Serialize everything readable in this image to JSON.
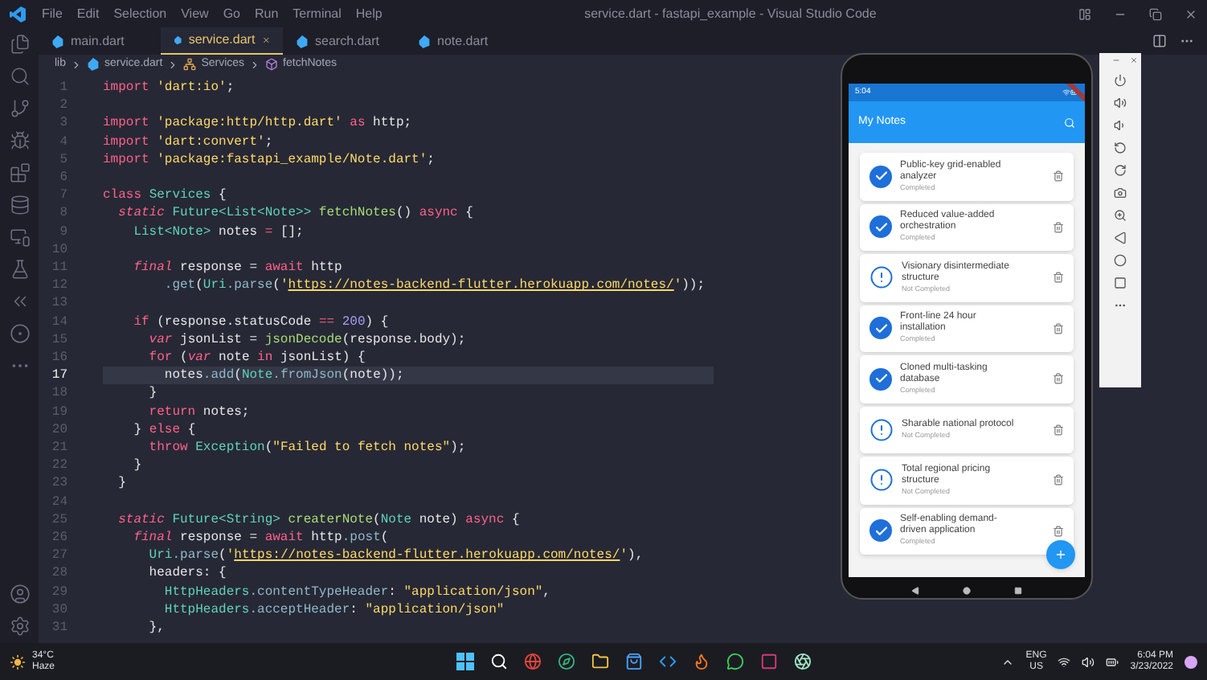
{
  "window": {
    "title": "service.dart - fastapi_example - Visual Studio Code",
    "menu": [
      "File",
      "Edit",
      "Selection",
      "View",
      "Go",
      "Run",
      "Terminal",
      "Help"
    ]
  },
  "tabs": [
    {
      "label": "main.dart",
      "selected": false
    },
    {
      "label": "service.dart",
      "selected": true
    },
    {
      "label": "search.dart",
      "selected": false
    },
    {
      "label": "note.dart",
      "selected": false
    }
  ],
  "breadcrumb": [
    {
      "kind": "folder",
      "label": "lib"
    },
    {
      "kind": "file",
      "label": "service.dart"
    },
    {
      "kind": "class",
      "label": "Services"
    },
    {
      "kind": "method",
      "label": "fetchNotes"
    }
  ],
  "editor": {
    "lines": [
      {
        "n": "1",
        "current": false,
        "tokens": [
          {
            "kind": "kw",
            "text": "import"
          },
          {
            "kind": "str",
            "text": " 'dart:io'"
          },
          {
            "kind": "txt",
            "text": ";"
          }
        ]
      },
      {
        "n": "2",
        "current": false
      },
      {
        "n": "3",
        "current": false,
        "tokens": [
          {
            "kind": "kw",
            "text": "import"
          },
          {
            "kind": "str",
            "text": " 'package:http/http.dart'"
          },
          {
            "kind": "kw",
            "text": " as"
          },
          {
            "kind": "txt",
            "text": " http;"
          }
        ]
      },
      {
        "n": "4",
        "current": false,
        "tokens": [
          {
            "kind": "kw",
            "text": "import"
          },
          {
            "kind": "str",
            "text": " 'dart:convert'"
          },
          {
            "kind": "txt",
            "text": ";"
          }
        ]
      },
      {
        "n": "5",
        "current": false,
        "tokens": [
          {
            "kind": "kw",
            "text": "import"
          },
          {
            "kind": "str",
            "text": " 'package:fastapi_example/Note.dart'"
          },
          {
            "kind": "txt",
            "text": ";"
          }
        ]
      },
      {
        "n": "6",
        "current": false
      },
      {
        "n": "7",
        "current": false,
        "tokens": [
          {
            "kind": "kw",
            "text": "class"
          },
          {
            "kind": "type",
            "text": " Services"
          },
          {
            "kind": "txt",
            "text": " {"
          }
        ]
      },
      {
        "n": "8",
        "current": false,
        "tokens": [
          {
            "kind": "ikw",
            "text": "  static"
          },
          {
            "kind": "type",
            "text": " Future<List<Note>>"
          },
          {
            "kind": "fn",
            "text": " fetchNotes"
          },
          {
            "kind": "txt",
            "text": "() "
          },
          {
            "kind": "kw",
            "text": "async"
          },
          {
            "kind": "txt",
            "text": " {"
          }
        ]
      },
      {
        "n": "9",
        "current": false,
        "tokens": [
          {
            "kind": "type",
            "text": "    List<Note>"
          },
          {
            "kind": "txt",
            "text": " notes "
          },
          {
            "kind": "kw",
            "text": "="
          },
          {
            "kind": "txt",
            "text": " [];"
          }
        ]
      },
      {
        "n": "10",
        "current": false
      },
      {
        "n": "11",
        "current": false,
        "tokens": [
          {
            "kind": "ikw",
            "text": "    final"
          },
          {
            "kind": "txt",
            "text": " response = "
          },
          {
            "kind": "kw",
            "text": "await"
          },
          {
            "kind": "txt",
            "text": " http"
          }
        ]
      },
      {
        "n": "12",
        "current": false,
        "tokens": [
          {
            "kind": "prop",
            "text": "        .get"
          },
          {
            "kind": "txt",
            "text": "("
          },
          {
            "kind": "type",
            "text": "Uri"
          },
          {
            "kind": "prop",
            "text": ".parse"
          },
          {
            "kind": "txt",
            "text": "("
          },
          {
            "kind": "str",
            "text": "'"
          },
          {
            "kind": "url",
            "text": "https://notes-backend-flutter.herokuapp.com/notes/"
          },
          {
            "kind": "str",
            "text": "'"
          },
          {
            "kind": "txt",
            "text": "));"
          }
        ]
      },
      {
        "n": "13",
        "current": false
      },
      {
        "n": "14",
        "current": false,
        "tokens": [
          {
            "kind": "kw",
            "text": "    if"
          },
          {
            "kind": "txt",
            "text": " (response.statusCode "
          },
          {
            "kind": "kw",
            "text": "=="
          },
          {
            "kind": "num",
            "text": " 200"
          },
          {
            "kind": "txt",
            "text": ") {"
          }
        ]
      },
      {
        "n": "15",
        "current": false,
        "tokens": [
          {
            "kind": "ikw",
            "text": "      var"
          },
          {
            "kind": "txt",
            "text": " jsonList = "
          },
          {
            "kind": "fn",
            "text": "jsonDecode"
          },
          {
            "kind": "txt",
            "text": "(response.body);"
          }
        ]
      },
      {
        "n": "16",
        "current": false,
        "tokens": [
          {
            "kind": "kw",
            "text": "      for"
          },
          {
            "kind": "txt",
            "text": " ("
          },
          {
            "kind": "ikw",
            "text": "var"
          },
          {
            "kind": "txt",
            "text": " note "
          },
          {
            "kind": "kw",
            "text": "in"
          },
          {
            "kind": "txt",
            "text": " jsonList) {"
          }
        ]
      },
      {
        "n": "17",
        "current": true,
        "tokens": [
          {
            "kind": "txt",
            "text": "        notes"
          },
          {
            "kind": "prop",
            "text": ".add"
          },
          {
            "kind": "txt",
            "text": "("
          },
          {
            "kind": "type",
            "text": "Note"
          },
          {
            "kind": "prop",
            "text": ".fromJson"
          },
          {
            "kind": "txt",
            "text": "(note));"
          }
        ]
      },
      {
        "n": "18",
        "current": false,
        "tokens": [
          {
            "kind": "txt",
            "text": "      }"
          }
        ]
      },
      {
        "n": "19",
        "current": false,
        "tokens": [
          {
            "kind": "kw",
            "text": "      return"
          },
          {
            "kind": "txt",
            "text": " notes;"
          }
        ]
      },
      {
        "n": "20",
        "current": false,
        "tokens": [
          {
            "kind": "txt",
            "text": "    } "
          },
          {
            "kind": "kw",
            "text": "else"
          },
          {
            "kind": "txt",
            "text": " {"
          }
        ]
      },
      {
        "n": "21",
        "current": false,
        "tokens": [
          {
            "kind": "kw",
            "text": "      throw"
          },
          {
            "kind": "type",
            "text": " Exception"
          },
          {
            "kind": "txt",
            "text": "("
          },
          {
            "kind": "str",
            "text": "\"Failed to fetch notes\""
          },
          {
            "kind": "txt",
            "text": ");"
          }
        ]
      },
      {
        "n": "22",
        "current": false,
        "tokens": [
          {
            "kind": "txt",
            "text": "    }"
          }
        ]
      },
      {
        "n": "23",
        "current": false,
        "tokens": [
          {
            "kind": "txt",
            "text": "  }"
          }
        ]
      },
      {
        "n": "24",
        "current": false
      },
      {
        "n": "25",
        "current": false,
        "tokens": [
          {
            "kind": "ikw",
            "text": "  static"
          },
          {
            "kind": "type",
            "text": " Future<String>"
          },
          {
            "kind": "fn",
            "text": " createrNote"
          },
          {
            "kind": "txt",
            "text": "("
          },
          {
            "kind": "type",
            "text": "Note"
          },
          {
            "kind": "txt",
            "text": " note) "
          },
          {
            "kind": "kw",
            "text": "async"
          },
          {
            "kind": "txt",
            "text": " {"
          }
        ]
      },
      {
        "n": "26",
        "current": false,
        "tokens": [
          {
            "kind": "ikw",
            "text": "    final"
          },
          {
            "kind": "txt",
            "text": " response = "
          },
          {
            "kind": "kw",
            "text": "await"
          },
          {
            "kind": "txt",
            "text": " http"
          },
          {
            "kind": "prop",
            "text": ".post"
          },
          {
            "kind": "txt",
            "text": "("
          }
        ]
      },
      {
        "n": "27",
        "current": false,
        "tokens": [
          {
            "kind": "type",
            "text": "      Uri"
          },
          {
            "kind": "prop",
            "text": ".parse"
          },
          {
            "kind": "txt",
            "text": "("
          },
          {
            "kind": "str",
            "text": "'"
          },
          {
            "kind": "url",
            "text": "https://notes-backend-flutter.herokuapp.com/notes/"
          },
          {
            "kind": "str",
            "text": "'"
          },
          {
            "kind": "txt",
            "text": "),"
          }
        ]
      },
      {
        "n": "28",
        "current": false,
        "tokens": [
          {
            "kind": "txt",
            "text": "      headers: {"
          }
        ]
      },
      {
        "n": "29",
        "current": false,
        "tokens": [
          {
            "kind": "type",
            "text": "        HttpHeaders"
          },
          {
            "kind": "prop",
            "text": ".contentTypeHeader"
          },
          {
            "kind": "txt",
            "text": ": "
          },
          {
            "kind": "str",
            "text": "\"application/json\""
          },
          {
            "kind": "txt",
            "text": ","
          }
        ]
      },
      {
        "n": "30",
        "current": false,
        "tokens": [
          {
            "kind": "type",
            "text": "        HttpHeaders"
          },
          {
            "kind": "prop",
            "text": ".acceptHeader"
          },
          {
            "kind": "txt",
            "text": ": "
          },
          {
            "kind": "str",
            "text": "\"application/json\""
          }
        ]
      },
      {
        "n": "31",
        "current": false,
        "tokens": [
          {
            "kind": "txt",
            "text": "      },"
          }
        ]
      }
    ]
  },
  "phone": {
    "time": "5:04",
    "app_title": "My Notes",
    "notes": [
      {
        "title": "Public-key grid-enabled analyzer",
        "status": "Completed",
        "completed": true
      },
      {
        "title": "Reduced value-added orchestration",
        "status": "Completed",
        "completed": true
      },
      {
        "title": "Visionary disintermediate structure",
        "status": "Not Completed",
        "completed": false
      },
      {
        "title": "Front-line 24 hour installation",
        "status": "Completed",
        "completed": true
      },
      {
        "title": "Cloned multi-tasking database",
        "status": "Completed",
        "completed": true
      },
      {
        "title": "Sharable national protocol",
        "status": "Not Completed",
        "completed": false
      },
      {
        "title": "Total regional pricing structure",
        "status": "Not Completed",
        "completed": false
      },
      {
        "title": "Self-enabling demand-driven application",
        "status": "Completed",
        "completed": true
      }
    ]
  },
  "taskbar": {
    "temperature": "34°C",
    "condition": "Haze",
    "language": "ENG",
    "region": "US",
    "time": "6:04 PM",
    "date": "3/23/2022"
  }
}
